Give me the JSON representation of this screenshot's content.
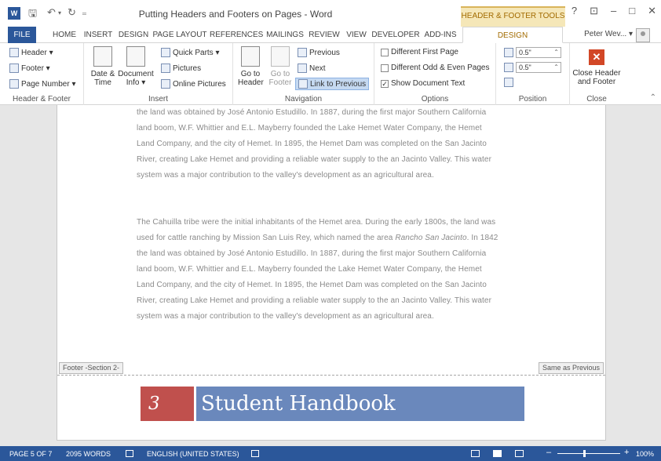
{
  "window": {
    "title": "Putting Headers and Footers on Pages - Word",
    "app_icon_label": "W",
    "contextual_group": "HEADER & FOOTER TOOLS",
    "help": "?",
    "ribbon_display": "⊡",
    "minimize": "–",
    "maximize": "□",
    "close": "✕"
  },
  "qat": {
    "save": "🖫",
    "undo": "↶",
    "undo_arrow": "▾",
    "redo": "↻",
    "customize": "₌"
  },
  "tabs": [
    {
      "label": "FILE"
    },
    {
      "label": "HOME"
    },
    {
      "label": "INSERT"
    },
    {
      "label": "DESIGN"
    },
    {
      "label": "PAGE LAYOUT"
    },
    {
      "label": "REFERENCES"
    },
    {
      "label": "MAILINGS"
    },
    {
      "label": "REVIEW"
    },
    {
      "label": "VIEW"
    },
    {
      "label": "DEVELOPER"
    },
    {
      "label": "ADD-INS"
    },
    {
      "label": "DESIGN"
    }
  ],
  "user": {
    "name": "Peter Wev...",
    "arrow": "▾"
  },
  "ribbon": {
    "header_footer": {
      "label": "Header & Footer",
      "header": "Header ▾",
      "footer": "Footer ▾",
      "page_number": "Page Number ▾"
    },
    "insert": {
      "label": "Insert",
      "date_line1": "Date &",
      "date_line2": "Time",
      "docinfo_line1": "Document",
      "docinfo_line2": "Info ▾",
      "quick_parts": "Quick Parts ▾",
      "pictures": "Pictures",
      "online_pictures": "Online Pictures"
    },
    "navigation": {
      "label": "Navigation",
      "goto_header_line1": "Go to",
      "goto_header_line2": "Header",
      "goto_footer_line1": "Go to",
      "goto_footer_line2": "Footer",
      "previous": "Previous",
      "next": "Next",
      "link_to_previous": "Link to Previous"
    },
    "options": {
      "label": "Options",
      "different_first": "Different First Page",
      "different_odd_even": "Different Odd & Even Pages",
      "show_doc_text": "Show Document Text",
      "check_mark": "✓"
    },
    "position": {
      "label": "Position",
      "header_from_top": "0.5\"",
      "footer_from_bottom": "0.5\""
    },
    "close": {
      "label": "Close",
      "button_line1": "Close Header",
      "button_line2": "and Footer",
      "x": "✕"
    },
    "collapse": "⌃"
  },
  "document": {
    "para1": [
      "the land was obtained by José Antonio Estudillo. In 1887, during the first major Southern California",
      "land boom, W.F. Whittier and E.L. Mayberry founded the Lake Hemet Water Company, the Hemet",
      "Land Company, and the city of Hemet. In 1895, the Hemet Dam was completed on the San Jacinto",
      "River, creating Lake Hemet and providing a reliable water supply to the an Jacinto Valley. This water",
      "system was a major contribution to the valley's development as an agricultural area."
    ],
    "para2_line1": "The Cahuilla tribe were the initial inhabitants of the Hemet area. During the early 1800s, the land was",
    "para2_line2_pre": "used for cattle ranching by Mission San Luis Rey, which named the area ",
    "para2_line2_em": "Rancho San Jacinto",
    "para2_line2_post": ". In 1842",
    "para2_rest": [
      "the land was obtained by José Antonio Estudillo. In 1887, during the first major Southern California",
      "land boom, W.F. Whittier and E.L. Mayberry founded the Lake Hemet Water Company, the Hemet",
      "Land Company, and the city of Hemet. In 1895, the Hemet Dam was completed on the San Jacinto",
      "River, creating Lake Hemet and providing a reliable water supply to the an Jacinto Valley. This water",
      "system was a major contribution to the valley's development as an agricultural area."
    ],
    "footer_tag": "Footer -Section 2-",
    "same_as_previous": "Same as Previous",
    "footer_page_number": "3",
    "footer_title": "Student Handbook"
  },
  "status": {
    "page": "PAGE 5 OF 7",
    "words": "2095 WORDS",
    "language": "ENGLISH (UNITED STATES)",
    "zoom_minus": "–",
    "zoom_plus": "+",
    "zoom": "100%",
    "zoom_fraction": 0.42
  },
  "colors": {
    "accent": "#2b579a",
    "contextual": "#a26b00",
    "footer_number_bg": "#c0504d",
    "footer_title_bg": "#6a88bc"
  }
}
